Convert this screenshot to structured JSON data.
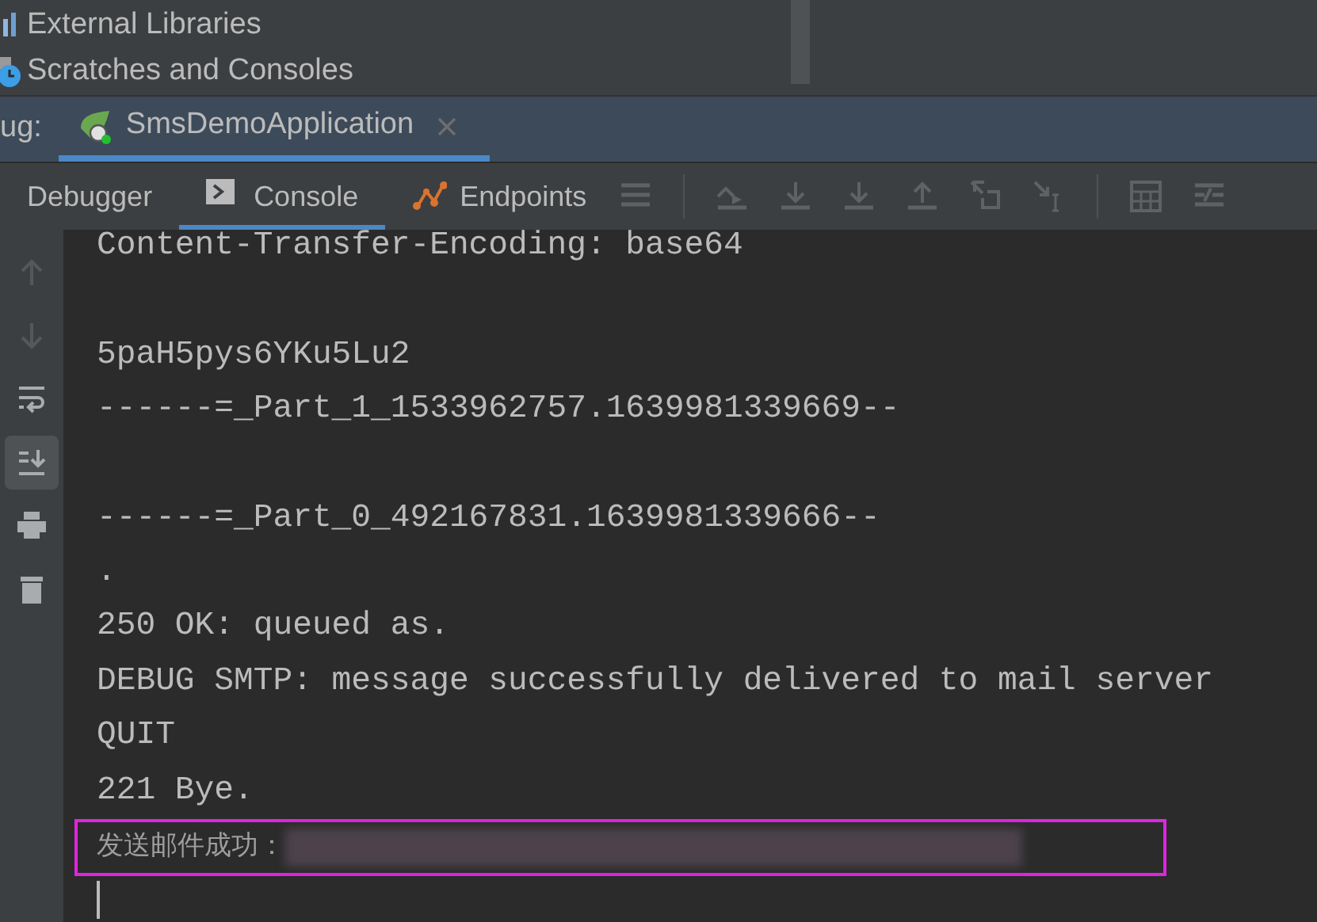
{
  "project_tree": {
    "items": [
      {
        "label": "External Libraries",
        "kind": "libraries"
      },
      {
        "label": "Scratches and Consoles",
        "kind": "scratches"
      }
    ]
  },
  "debug_bar": {
    "label": "ug:",
    "tabs": [
      {
        "label": "SmsDemoApplication",
        "selected": true,
        "closable": true
      }
    ]
  },
  "toolbar": {
    "tabs": [
      {
        "label": "Debugger",
        "kind": "plain",
        "selected": false
      },
      {
        "label": "Console",
        "kind": "console",
        "selected": true
      },
      {
        "label": "Endpoints",
        "kind": "endpoints",
        "selected": false
      }
    ],
    "icons": [
      {
        "kind": "menu"
      },
      {
        "kind": "separator"
      },
      {
        "kind": "step-over"
      },
      {
        "kind": "step-into"
      },
      {
        "kind": "force-step-into"
      },
      {
        "kind": "step-out"
      },
      {
        "kind": "drop-frame"
      },
      {
        "kind": "run-to-cursor"
      },
      {
        "kind": "separator"
      },
      {
        "kind": "evaluate"
      },
      {
        "kind": "trace"
      }
    ]
  },
  "gutter": [
    {
      "kind": "up",
      "disabled": true,
      "selected": false
    },
    {
      "kind": "down",
      "disabled": true,
      "selected": false
    },
    {
      "kind": "wrap",
      "disabled": false,
      "selected": false
    },
    {
      "kind": "scroll-end",
      "disabled": false,
      "selected": true
    },
    {
      "kind": "print",
      "disabled": false,
      "selected": false
    },
    {
      "kind": "trash",
      "disabled": false,
      "selected": false
    }
  ],
  "console": {
    "caret_visible": true,
    "lines": [
      {
        "kind": "text",
        "text": "Content-Transfer-Encoding: base64"
      },
      {
        "kind": "blank"
      },
      {
        "kind": "text",
        "text": "5paH5pys6YKu5Lu2"
      },
      {
        "kind": "text",
        "text": "------=_Part_1_1533962757.1639981339669--"
      },
      {
        "kind": "blank"
      },
      {
        "kind": "text",
        "text": "------=_Part_0_492167831.1639981339666--"
      },
      {
        "kind": "text",
        "text": "."
      },
      {
        "kind": "text",
        "text": "250 OK: queued as."
      },
      {
        "kind": "text",
        "text": "DEBUG SMTP: message successfully delivered to mail server"
      },
      {
        "kind": "text",
        "text": "QUIT"
      },
      {
        "kind": "text",
        "text": "221 Bye."
      },
      {
        "kind": "result",
        "text": "发送邮件成功：",
        "redacted": true,
        "highlighted": true
      }
    ]
  }
}
